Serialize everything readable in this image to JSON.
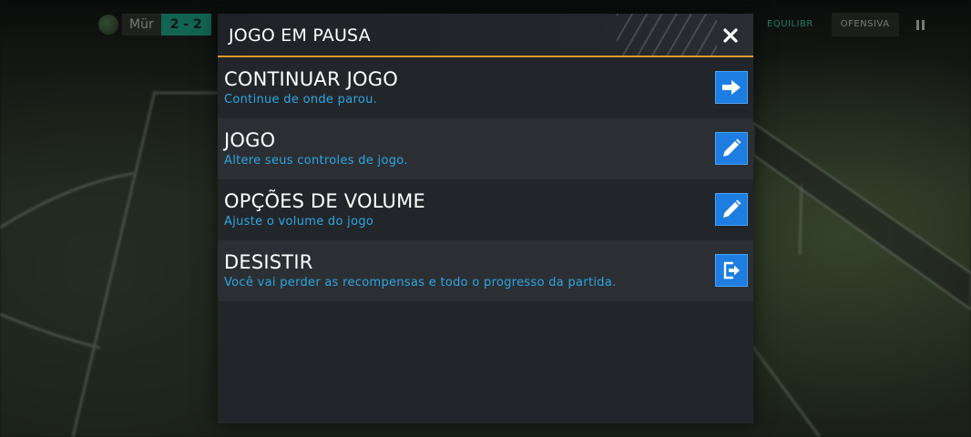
{
  "hud": {
    "team_label": "Mür",
    "score": "2 - 2",
    "tactics": [
      "EQUILIBR",
      "OFENSIVA"
    ]
  },
  "dialog": {
    "title": "JOGO EM PAUSA",
    "close_icon": "close-icon",
    "items": [
      {
        "title": "CONTINUAR JOGO",
        "description": "Continue de onde parou.",
        "icon": "arrow-right-icon"
      },
      {
        "title": "JOGO",
        "description": "Altere seus controles de jogo.",
        "icon": "pencil-icon"
      },
      {
        "title": "OPÇÕES DE VOLUME",
        "description": "Ajuste o volume do jogo",
        "icon": "pencil-icon"
      },
      {
        "title": "DESISTIR",
        "description": "Você vai perder as recompensas e todo o progresso da partida.",
        "icon": "exit-icon"
      }
    ]
  },
  "colors": {
    "accent_orange": "#e19a2c",
    "action_blue": "#1e7de0",
    "description_blue": "#2ea6e0",
    "score_teal": "#18a88a"
  }
}
